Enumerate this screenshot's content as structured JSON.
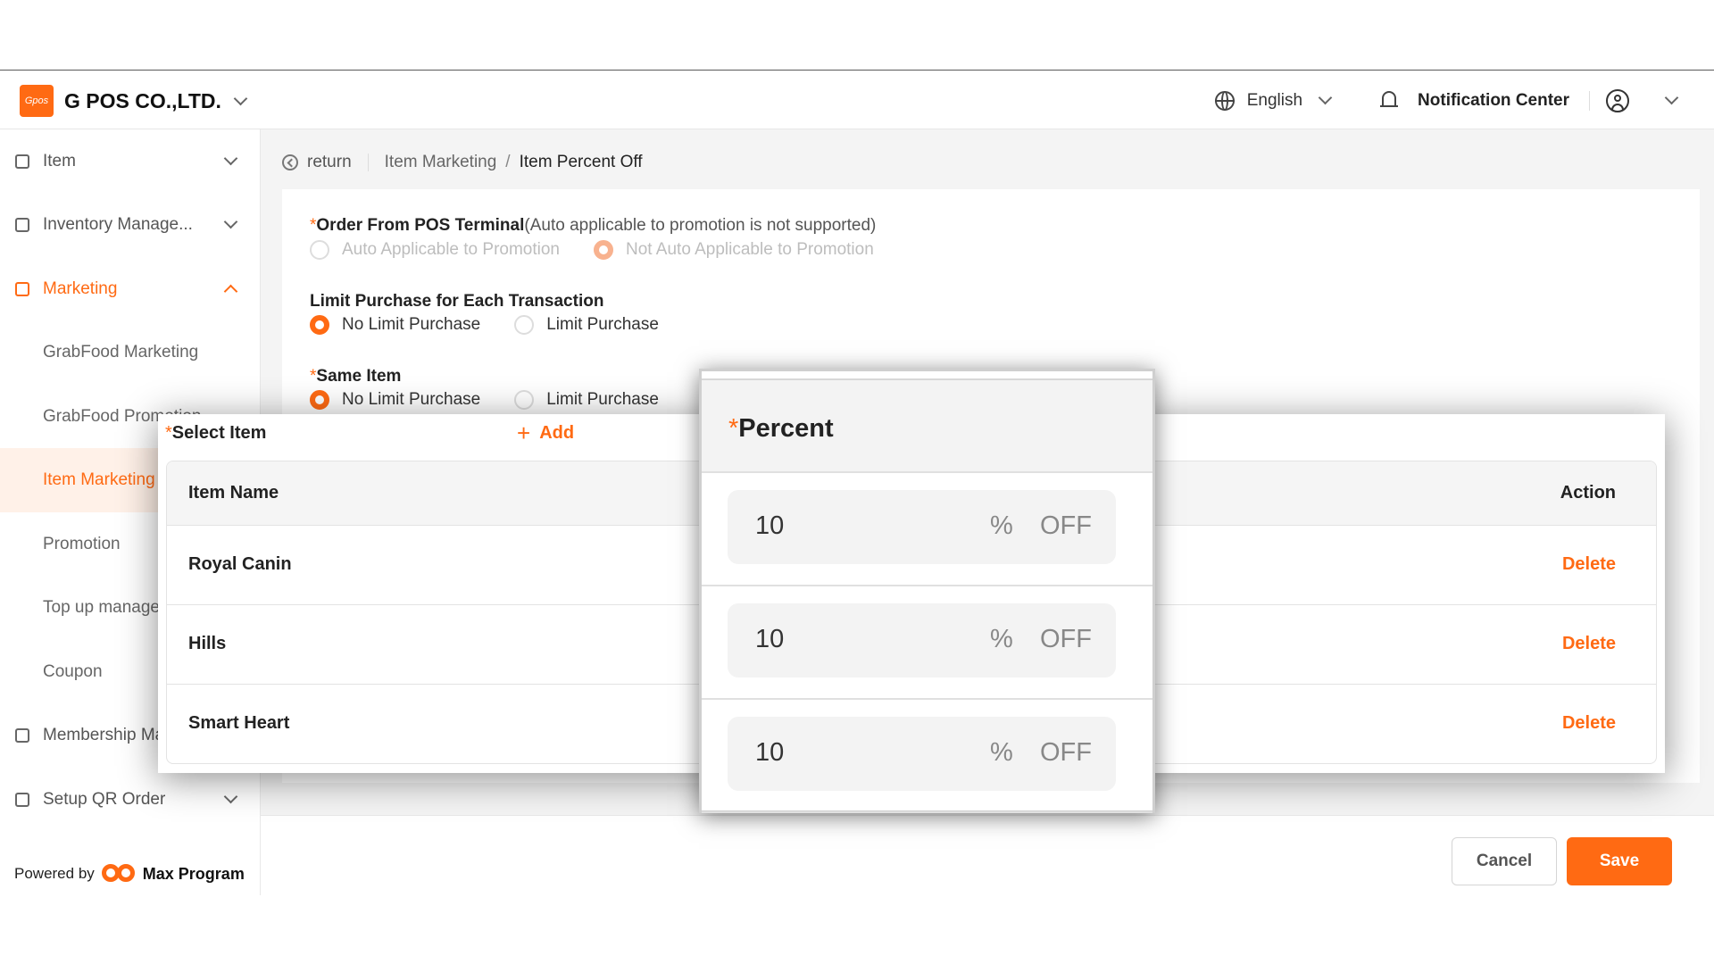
{
  "header": {
    "logo_text": "Gpos",
    "company": "G POS CO.,LTD.",
    "language": "English",
    "notification": "Notification Center"
  },
  "sidebar": {
    "items": [
      {
        "label": "Item"
      },
      {
        "label": "Inventory Manage..."
      },
      {
        "label": "Marketing"
      },
      {
        "label": "GrabFood Marketing"
      },
      {
        "label": "GrabFood Promotion"
      },
      {
        "label": "Item Marketing"
      },
      {
        "label": "Promotion"
      },
      {
        "label": "Top up management"
      },
      {
        "label": "Coupon"
      },
      {
        "label": "Membership Management"
      },
      {
        "label": "Setup QR Order"
      }
    ],
    "powered_by": "Powered by",
    "powered_brand": "Max Program"
  },
  "breadcrumb": {
    "return": "return",
    "parent": "Item Marketing",
    "separator": "/",
    "current": "Item Percent Off"
  },
  "form": {
    "order_from": {
      "required_mark": "*",
      "label": "Order From POS Terminal",
      "hint": "(Auto applicable to promotion is not supported)",
      "options": [
        "Auto Applicable to Promotion",
        "Not Auto Applicable to Promotion"
      ],
      "selected": "Not Auto Applicable to Promotion"
    },
    "limit_transaction": {
      "label": "Limit Purchase for Each Transaction",
      "options": [
        "No Limit Purchase",
        "Limit Purchase"
      ],
      "selected": "No Limit Purchase"
    },
    "same_item": {
      "required_mark": "*",
      "label": "Same Item",
      "options": [
        "No Limit Purchase",
        "Limit Purchase"
      ],
      "selected": "No Limit Purchase"
    }
  },
  "select_item": {
    "required_mark": "*",
    "label": "Select Item",
    "add_label": "Add",
    "columns": {
      "name": "Item Name",
      "action": "Action"
    },
    "rows": [
      {
        "name": "Royal Canin",
        "action": "Delete"
      },
      {
        "name": "Hills",
        "action": "Delete"
      },
      {
        "name": "Smart Heart",
        "action": "Delete"
      }
    ]
  },
  "percent": {
    "required_mark": "*",
    "label": "Percent",
    "rows": [
      {
        "value": "10",
        "symbol": "%",
        "suffix": "OFF"
      },
      {
        "value": "10",
        "symbol": "%",
        "suffix": "OFF"
      },
      {
        "value": "10",
        "symbol": "%",
        "suffix": "OFF"
      }
    ]
  },
  "footer": {
    "cancel": "Cancel",
    "save": "Save"
  },
  "colors": {
    "accent": "#ff6a13",
    "accent_light": "#fff1e8"
  }
}
